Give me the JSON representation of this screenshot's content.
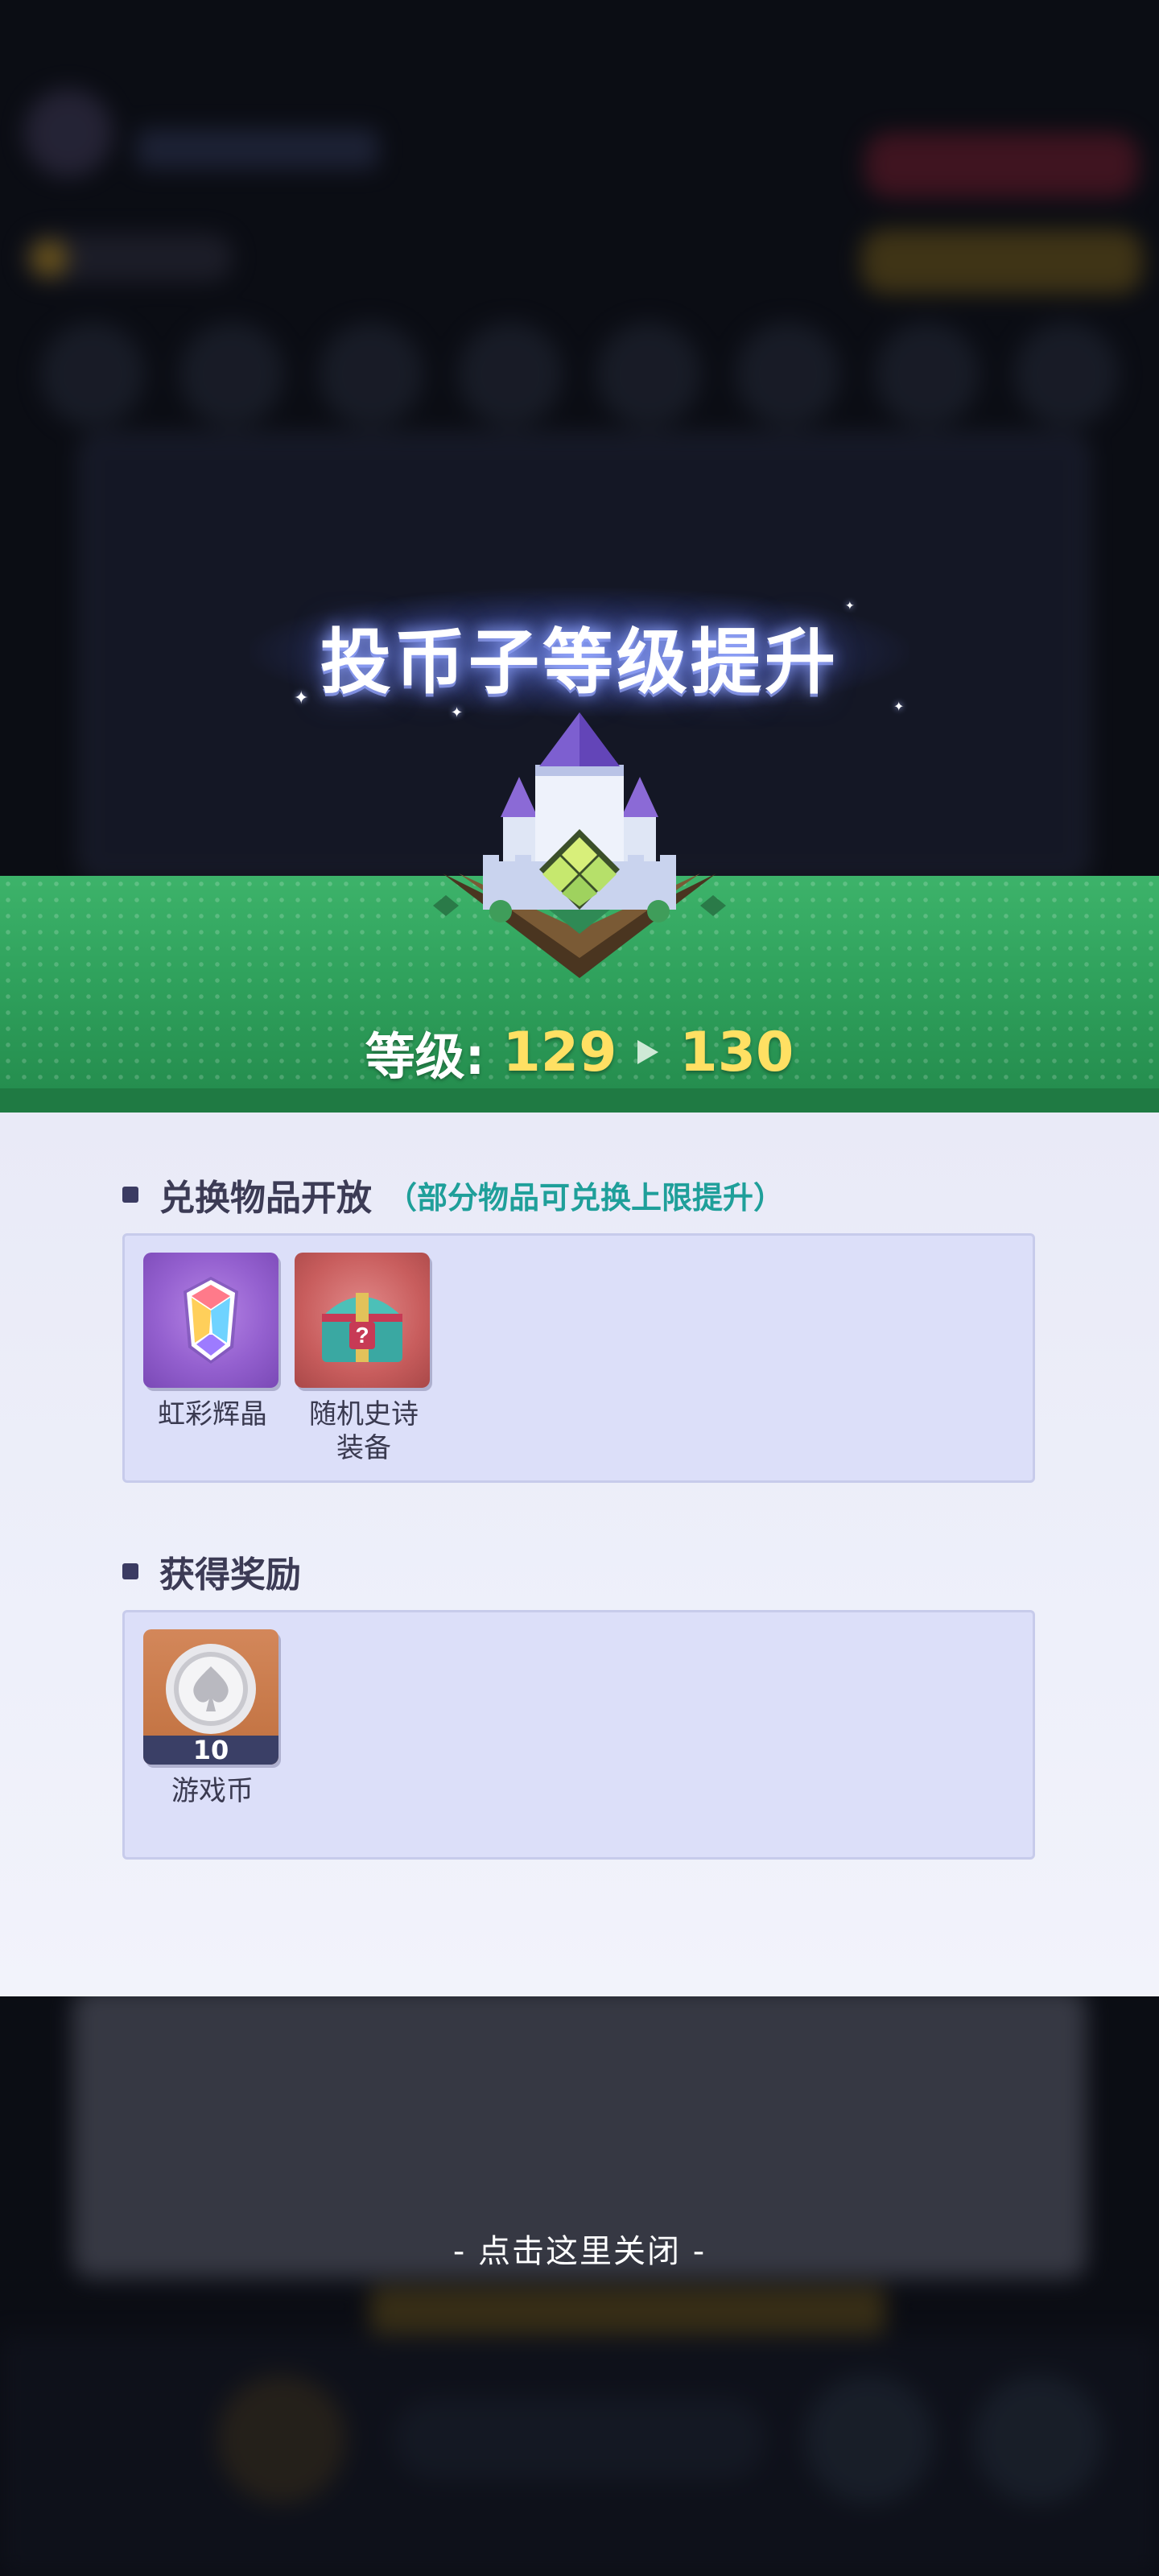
{
  "popup": {
    "title": "投币子等级提升",
    "level_label": "等级:",
    "level_from": "129",
    "level_to": "130"
  },
  "exchange_section": {
    "heading": "兑换物品开放",
    "subheading": "（部分物品可兑换上限提升）",
    "items": [
      {
        "name": "虹彩辉晶",
        "icon": "rainbow-crystal-icon"
      },
      {
        "name": "随机史诗装备",
        "name_line1": "随机史诗",
        "name_line2": "装备",
        "icon": "mystery-chest-icon"
      }
    ]
  },
  "reward_section": {
    "heading": "获得奖励",
    "items": [
      {
        "name": "游戏币",
        "count": "10",
        "icon": "spade-coin-icon"
      }
    ]
  },
  "close_hint": "- 点击这里关闭 -",
  "colors": {
    "banner_green": "#2fa15c",
    "level_number_yellow": "#ffe063",
    "section_sub_teal": "#1f9f9a",
    "panel_bg": "#eef0fa"
  }
}
